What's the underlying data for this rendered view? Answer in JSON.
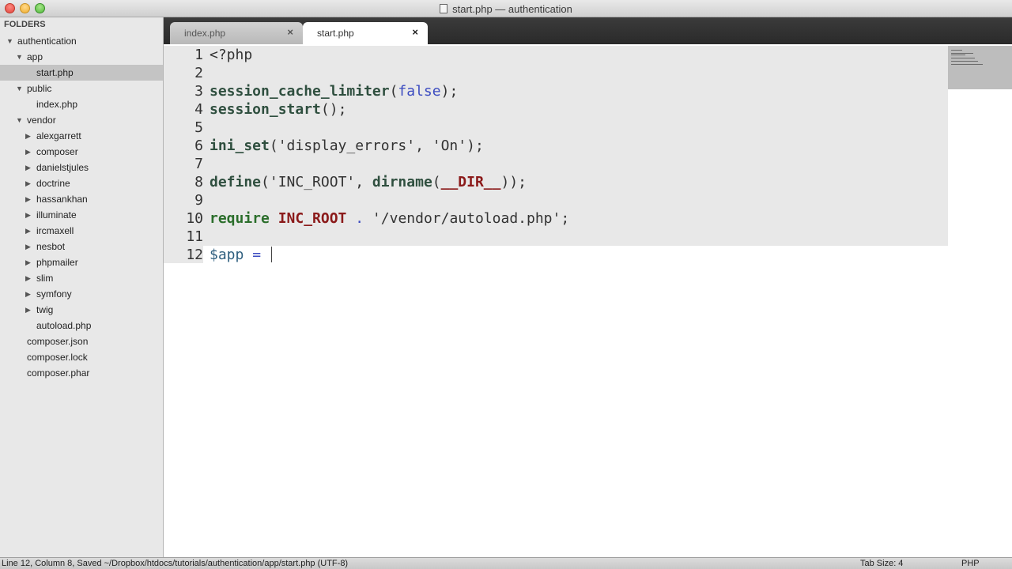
{
  "window": {
    "title": "start.php — authentication"
  },
  "sidebar": {
    "header": "FOLDERS",
    "tree": [
      {
        "label": "authentication",
        "type": "folder",
        "expanded": true,
        "depth": 0
      },
      {
        "label": "app",
        "type": "folder",
        "expanded": true,
        "depth": 1
      },
      {
        "label": "start.php",
        "type": "file",
        "depth": 2,
        "selected": true
      },
      {
        "label": "public",
        "type": "folder",
        "expanded": true,
        "depth": 1
      },
      {
        "label": "index.php",
        "type": "file",
        "depth": 2
      },
      {
        "label": "vendor",
        "type": "folder",
        "expanded": true,
        "depth": 1
      },
      {
        "label": "alexgarrett",
        "type": "folder",
        "expanded": false,
        "depth": 2
      },
      {
        "label": "composer",
        "type": "folder",
        "expanded": false,
        "depth": 2
      },
      {
        "label": "danielstjules",
        "type": "folder",
        "expanded": false,
        "depth": 2
      },
      {
        "label": "doctrine",
        "type": "folder",
        "expanded": false,
        "depth": 2
      },
      {
        "label": "hassankhan",
        "type": "folder",
        "expanded": false,
        "depth": 2
      },
      {
        "label": "illuminate",
        "type": "folder",
        "expanded": false,
        "depth": 2
      },
      {
        "label": "ircmaxell",
        "type": "folder",
        "expanded": false,
        "depth": 2
      },
      {
        "label": "nesbot",
        "type": "folder",
        "expanded": false,
        "depth": 2
      },
      {
        "label": "phpmailer",
        "type": "folder",
        "expanded": false,
        "depth": 2
      },
      {
        "label": "slim",
        "type": "folder",
        "expanded": false,
        "depth": 2
      },
      {
        "label": "symfony",
        "type": "folder",
        "expanded": false,
        "depth": 2
      },
      {
        "label": "twig",
        "type": "folder",
        "expanded": false,
        "depth": 2
      },
      {
        "label": "autoload.php",
        "type": "file",
        "depth": 2
      },
      {
        "label": "composer.json",
        "type": "file",
        "depth": 1
      },
      {
        "label": "composer.lock",
        "type": "file",
        "depth": 1
      },
      {
        "label": "composer.phar",
        "type": "file",
        "depth": 1
      }
    ]
  },
  "tabs": [
    {
      "label": "index.php",
      "active": false,
      "close": "×"
    },
    {
      "label": "start.php",
      "active": true,
      "close": "×"
    }
  ],
  "editor": {
    "line_numbers": [
      "1",
      "2",
      "3",
      "4",
      "5",
      "6",
      "7",
      "8",
      "9",
      "10",
      "11",
      "12"
    ],
    "lines": [
      [
        {
          "t": "<?php",
          "c": ""
        }
      ],
      [],
      [
        {
          "t": "session_cache_limiter",
          "c": "kw"
        },
        {
          "t": "(",
          "c": ""
        },
        {
          "t": "false",
          "c": "lit"
        },
        {
          "t": ");",
          "c": ""
        }
      ],
      [
        {
          "t": "session_start",
          "c": "kw"
        },
        {
          "t": "();",
          "c": ""
        }
      ],
      [],
      [
        {
          "t": "ini_set",
          "c": "kw"
        },
        {
          "t": "('display_errors', 'On');",
          "c": "str"
        }
      ],
      [],
      [
        {
          "t": "define",
          "c": "kw"
        },
        {
          "t": "('INC_ROOT', ",
          "c": "str"
        },
        {
          "t": "dirname",
          "c": "kw"
        },
        {
          "t": "(",
          "c": ""
        },
        {
          "t": "__DIR__",
          "c": "const"
        },
        {
          "t": "));",
          "c": ""
        }
      ],
      [],
      [
        {
          "t": "require",
          "c": "kwg"
        },
        {
          "t": " ",
          "c": ""
        },
        {
          "t": "INC_ROOT",
          "c": "const"
        },
        {
          "t": " ",
          "c": ""
        },
        {
          "t": ".",
          "c": "op"
        },
        {
          "t": " '/vendor/autoload.php';",
          "c": "str"
        }
      ],
      [],
      [
        {
          "t": "$app",
          "c": "var"
        },
        {
          "t": " ",
          "c": ""
        },
        {
          "t": "=",
          "c": "op"
        },
        {
          "t": " ",
          "c": ""
        }
      ]
    ]
  },
  "statusbar": {
    "left": "Line 12, Column 8, Saved ~/Dropbox/htdocs/tutorials/authentication/app/start.php (UTF-8)",
    "tab_size": "Tab Size: 4",
    "syntax": "PHP"
  },
  "icons": {
    "expanded": "▼",
    "collapsed": "▶",
    "document": "document-icon"
  }
}
